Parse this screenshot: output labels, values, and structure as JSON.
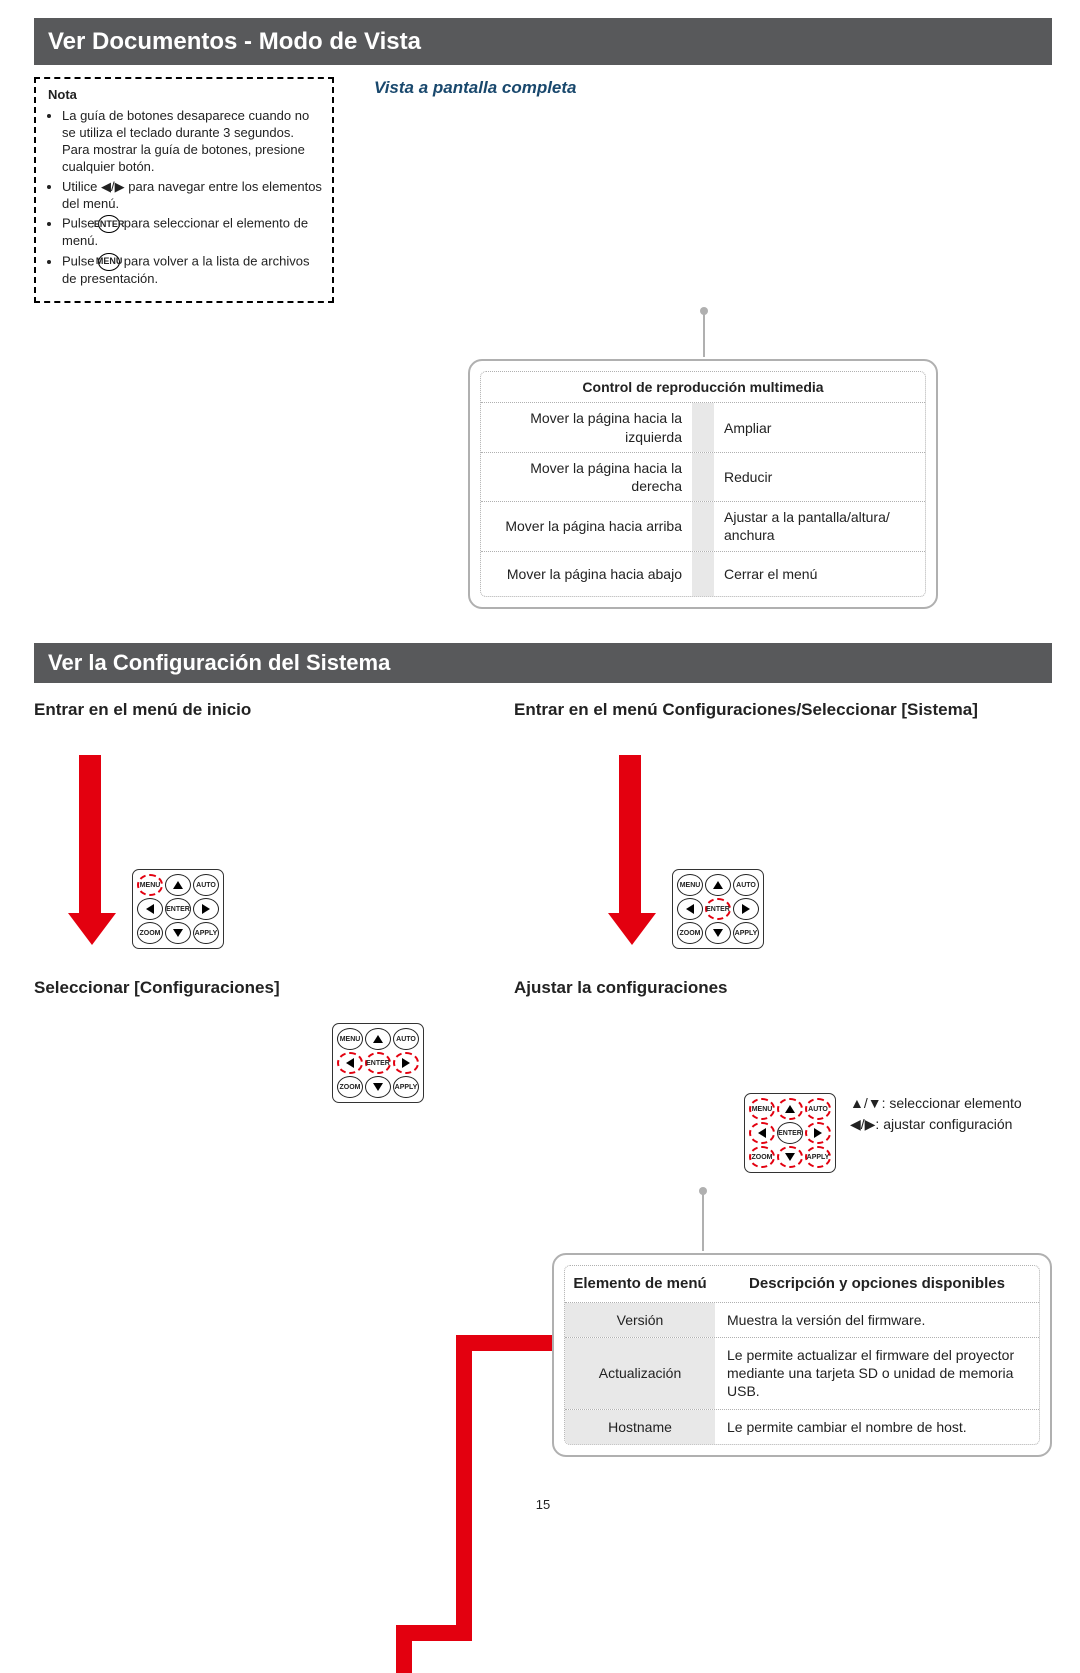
{
  "page_number": "15",
  "section1_title": "Ver Documentos - Modo de Vista",
  "nota": {
    "title": "Nota",
    "b1": "La guía de botones desaparece cuando no se utiliza el teclado durante 3 segundos. Para mostrar la guía de botones, presione cualquier botón.",
    "b2a": "Utilice ",
    "b2b": " para navegar entre los elementos del menú.",
    "b3a": "Pulse ",
    "b3b": " para seleccionar el elemento de menú.",
    "b4a": "Pulse ",
    "b4b": " para volver a la lista de archivos de presentación.",
    "enter_label": "ENTER",
    "menu_label": "MENU"
  },
  "fullscreen_heading": "Vista a pantalla completa",
  "playback": {
    "title": "Control de reproducción multimedia",
    "rows": [
      {
        "l": "Mover la página hacia la izquierda",
        "r": "Ampliar"
      },
      {
        "l": "Mover la página hacia la derecha",
        "r": "Reducir"
      },
      {
        "l": "Mover la página hacia arriba",
        "r": "Ajustar a la pantalla/altura/ anchura"
      },
      {
        "l": "Mover la página hacia abajo",
        "r": "Cerrar el menú"
      }
    ]
  },
  "section2_title": "Ver la Configuración del Sistema",
  "steps": {
    "s1": "Entrar en el menú de inicio",
    "s2": "Entrar en el menú Configuraciones/Seleccionar [Sistema]",
    "s3": "Seleccionar [Configuraciones]",
    "s4": "Ajustar la configuraciones"
  },
  "legend": {
    "l1": "▲/▼: seleccionar elemento",
    "l2": "◀/▶: ajustar configuración"
  },
  "settings_table": {
    "h1": "Elemento de menú",
    "h2": "Descripción y opciones disponibles",
    "rows": [
      {
        "c1": "Versión",
        "c2": "Muestra la versión del firmware."
      },
      {
        "c1": "Actualización",
        "c2": "Le permite actualizar el firmware del proyector mediante una tarjeta SD o unidad de memoria USB."
      },
      {
        "c1": "Hostname",
        "c2": "Le permite cambiar el nombre de host."
      }
    ]
  }
}
